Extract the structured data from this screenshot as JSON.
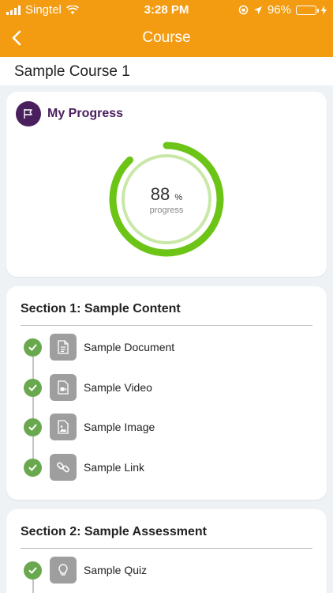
{
  "status_bar": {
    "carrier": "Singtel",
    "time": "3:28 PM",
    "battery": "96%"
  },
  "nav": {
    "title": "Course"
  },
  "course": {
    "title": "Sample Course 1"
  },
  "progress": {
    "title": "My Progress",
    "value": "88",
    "percent_value": 88,
    "unit": "%",
    "label": "progress"
  },
  "sections": [
    {
      "title": "Section 1: Sample Content",
      "items": [
        {
          "label": "Sample Document",
          "icon": "document-icon"
        },
        {
          "label": "Sample Video",
          "icon": "video-icon"
        },
        {
          "label": "Sample Image",
          "icon": "image-icon"
        },
        {
          "label": "Sample Link",
          "icon": "link-icon"
        }
      ]
    },
    {
      "title": "Section 2: Sample Assessment",
      "items": [
        {
          "label": "Sample Quiz",
          "icon": "lightbulb-icon"
        }
      ]
    }
  ],
  "colors": {
    "header": "#f39c12",
    "brand_purple": "#4a1f5e",
    "progress_green": "#6cc417",
    "progress_track": "#c9e8a8",
    "check_green": "#6aa84f"
  }
}
